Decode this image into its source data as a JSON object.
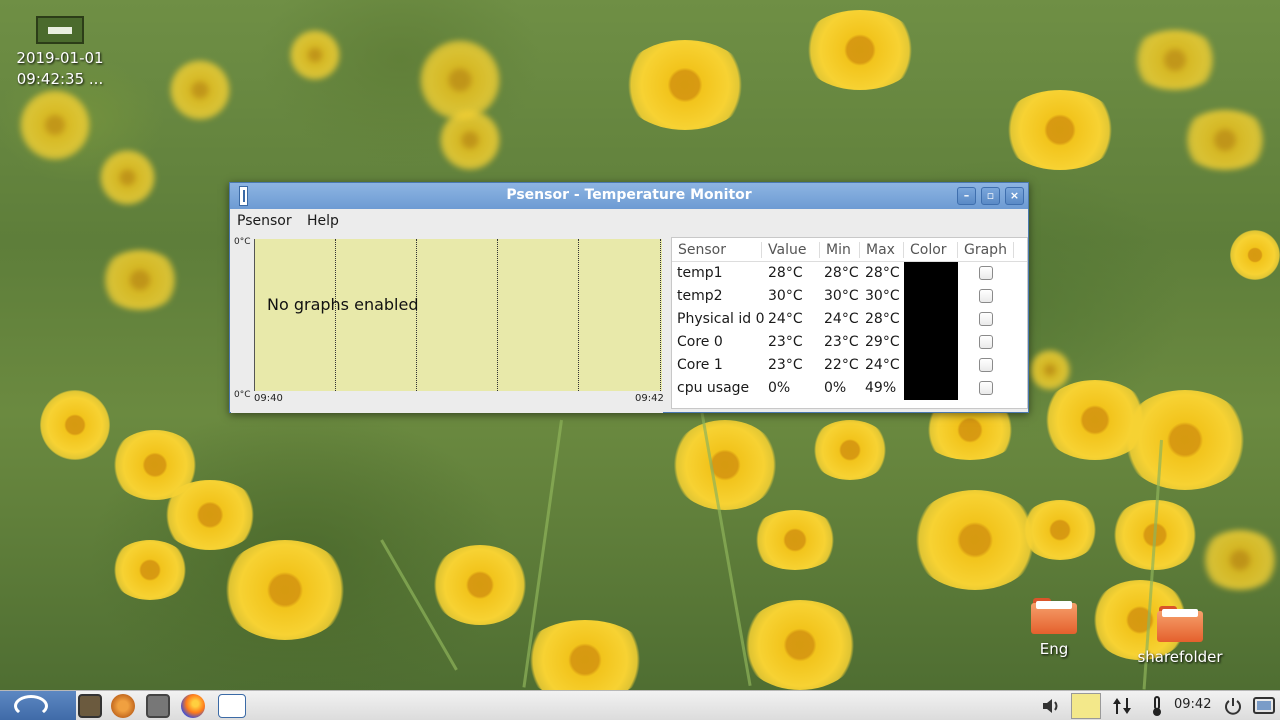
{
  "desktop": {
    "clock_widget": {
      "date": "2019-01-01",
      "time": "09:42:35 ..."
    },
    "folders": [
      {
        "label": "Eng"
      },
      {
        "label": "sharefolder"
      }
    ]
  },
  "window": {
    "title": "Psensor - Temperature Monitor",
    "controls": {
      "minimize": "–",
      "maximize": "▫",
      "close": "×"
    },
    "menu": [
      "Psensor",
      "Help"
    ],
    "graph": {
      "message": "No graphs enabled",
      "y_top": "0°C",
      "y_bottom": "0°C",
      "x_start": "09:40",
      "x_end": "09:42"
    },
    "table": {
      "headers": [
        "Sensor",
        "Value",
        "Min",
        "Max",
        "Color",
        "Graph"
      ],
      "rows": [
        {
          "sensor": "temp1",
          "value": "28°C",
          "min": "28°C",
          "max": "28°C",
          "graph": false
        },
        {
          "sensor": "temp2",
          "value": "30°C",
          "min": "30°C",
          "max": "30°C",
          "graph": false
        },
        {
          "sensor": "Physical id 0",
          "value": "24°C",
          "min": "24°C",
          "max": "28°C",
          "graph": false
        },
        {
          "sensor": "Core 0",
          "value": "23°C",
          "min": "23°C",
          "max": "29°C",
          "graph": false
        },
        {
          "sensor": "Core 1",
          "value": "23°C",
          "min": "22°C",
          "max": "24°C",
          "graph": false
        },
        {
          "sensor": "cpu usage",
          "value": "0%",
          "min": "0%",
          "max": "49%",
          "graph": false
        }
      ],
      "color_swatch": "#000000"
    }
  },
  "taskbar": {
    "clock": "09:42",
    "launchers": [
      "menu-logo-icon",
      "file-manager-icon",
      "settings-icon",
      "screenshot-icon",
      "firefox-icon",
      "psensor-icon"
    ],
    "tray": [
      "volume-icon",
      "notes-icon",
      "network-icon",
      "thermometer-icon",
      "power-icon",
      "desktop-icon"
    ]
  }
}
